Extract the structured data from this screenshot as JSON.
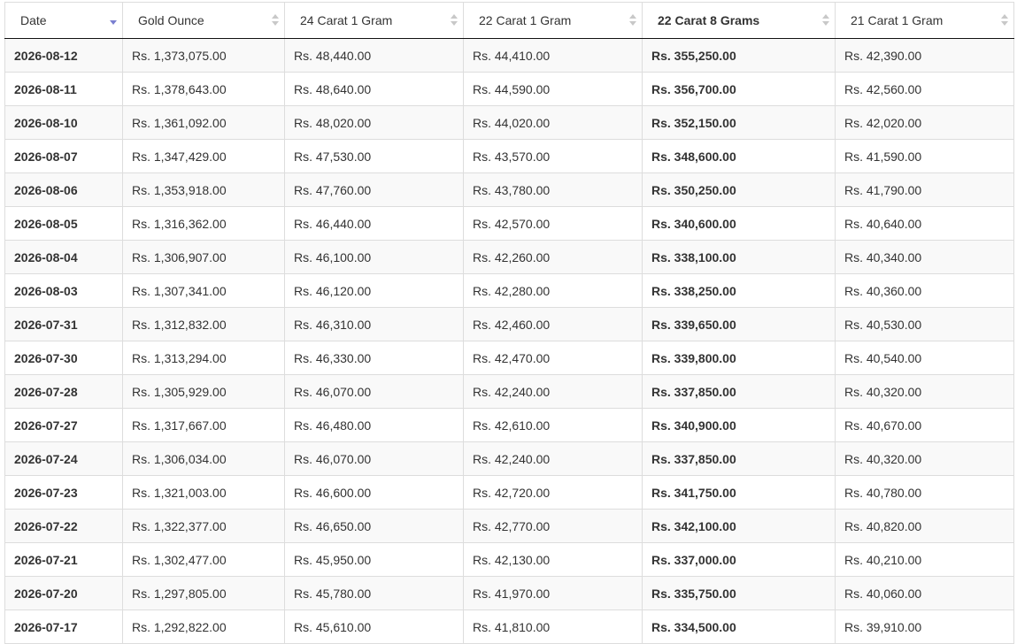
{
  "table": {
    "headers": [
      {
        "label": "Date",
        "sort": "desc"
      },
      {
        "label": "Gold Ounce",
        "sort": "none"
      },
      {
        "label": "24 Carat 1 Gram",
        "sort": "none"
      },
      {
        "label": "22 Carat 1 Gram",
        "sort": "none"
      },
      {
        "label": "22 Carat 8 Grams",
        "sort": "none"
      },
      {
        "label": "21 Carat 1 Gram",
        "sort": "none"
      }
    ],
    "rows": [
      [
        "2026-08-12",
        "Rs. 1,373,075.00",
        "Rs. 48,440.00",
        "Rs. 44,410.00",
        "Rs. 355,250.00",
        "Rs. 42,390.00"
      ],
      [
        "2026-08-11",
        "Rs. 1,378,643.00",
        "Rs. 48,640.00",
        "Rs. 44,590.00",
        "Rs. 356,700.00",
        "Rs. 42,560.00"
      ],
      [
        "2026-08-10",
        "Rs. 1,361,092.00",
        "Rs. 48,020.00",
        "Rs. 44,020.00",
        "Rs. 352,150.00",
        "Rs. 42,020.00"
      ],
      [
        "2026-08-07",
        "Rs. 1,347,429.00",
        "Rs. 47,530.00",
        "Rs. 43,570.00",
        "Rs. 348,600.00",
        "Rs. 41,590.00"
      ],
      [
        "2026-08-06",
        "Rs. 1,353,918.00",
        "Rs. 47,760.00",
        "Rs. 43,780.00",
        "Rs. 350,250.00",
        "Rs. 41,790.00"
      ],
      [
        "2026-08-05",
        "Rs. 1,316,362.00",
        "Rs. 46,440.00",
        "Rs. 42,570.00",
        "Rs. 340,600.00",
        "Rs. 40,640.00"
      ],
      [
        "2026-08-04",
        "Rs. 1,306,907.00",
        "Rs. 46,100.00",
        "Rs. 42,260.00",
        "Rs. 338,100.00",
        "Rs. 40,340.00"
      ],
      [
        "2026-08-03",
        "Rs. 1,307,341.00",
        "Rs. 46,120.00",
        "Rs. 42,280.00",
        "Rs. 338,250.00",
        "Rs. 40,360.00"
      ],
      [
        "2026-07-31",
        "Rs. 1,312,832.00",
        "Rs. 46,310.00",
        "Rs. 42,460.00",
        "Rs. 339,650.00",
        "Rs. 40,530.00"
      ],
      [
        "2026-07-30",
        "Rs. 1,313,294.00",
        "Rs. 46,330.00",
        "Rs. 42,470.00",
        "Rs. 339,800.00",
        "Rs. 40,540.00"
      ],
      [
        "2026-07-28",
        "Rs. 1,305,929.00",
        "Rs. 46,070.00",
        "Rs. 42,240.00",
        "Rs. 337,850.00",
        "Rs. 40,320.00"
      ],
      [
        "2026-07-27",
        "Rs. 1,317,667.00",
        "Rs. 46,480.00",
        "Rs. 42,610.00",
        "Rs. 340,900.00",
        "Rs. 40,670.00"
      ],
      [
        "2026-07-24",
        "Rs. 1,306,034.00",
        "Rs. 46,070.00",
        "Rs. 42,240.00",
        "Rs. 337,850.00",
        "Rs. 40,320.00"
      ],
      [
        "2026-07-23",
        "Rs. 1,321,003.00",
        "Rs. 46,600.00",
        "Rs. 42,720.00",
        "Rs. 341,750.00",
        "Rs. 40,780.00"
      ],
      [
        "2026-07-22",
        "Rs. 1,322,377.00",
        "Rs. 46,650.00",
        "Rs. 42,770.00",
        "Rs. 342,100.00",
        "Rs. 40,820.00"
      ],
      [
        "2026-07-21",
        "Rs. 1,302,477.00",
        "Rs. 45,950.00",
        "Rs. 42,130.00",
        "Rs. 337,000.00",
        "Rs. 40,210.00"
      ],
      [
        "2026-07-20",
        "Rs. 1,297,805.00",
        "Rs. 45,780.00",
        "Rs. 41,970.00",
        "Rs. 335,750.00",
        "Rs. 40,060.00"
      ],
      [
        "2026-07-17",
        "Rs. 1,292,822.00",
        "Rs. 45,610.00",
        "Rs. 41,810.00",
        "Rs. 334,500.00",
        "Rs. 39,910.00"
      ]
    ]
  },
  "icons": {
    "sort_active": "sort-descending-icon",
    "sort_inactive": "sort-both-icon"
  },
  "colors": {
    "sort_active": "#7a7fd0",
    "sort_inactive": "#c8c8c8",
    "row_stripe": "#f9f9f9",
    "border": "#dddddd"
  }
}
